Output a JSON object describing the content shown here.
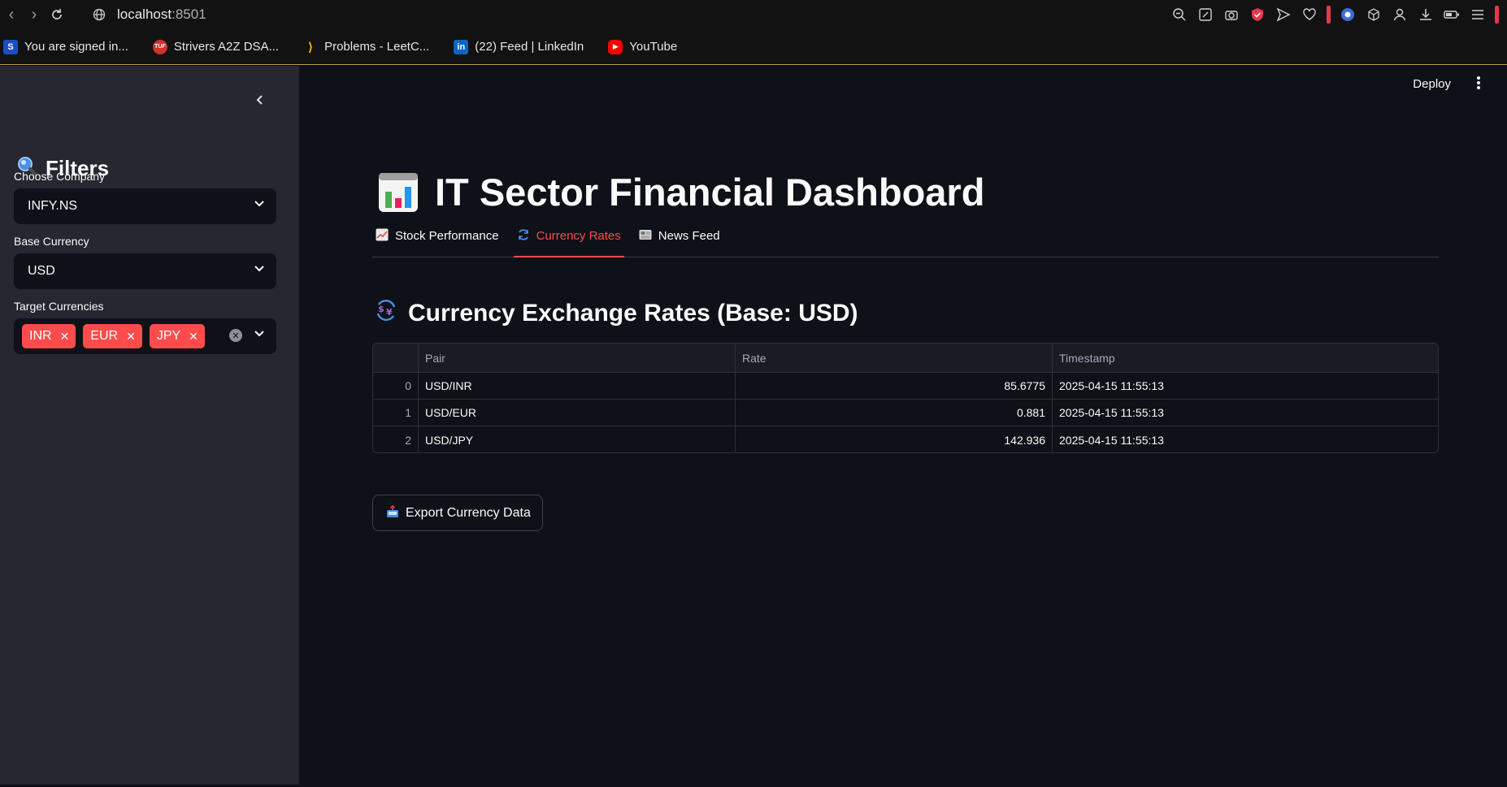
{
  "browser": {
    "url_host": "localhost",
    "url_port": ":8501",
    "bookmarks": [
      {
        "label": "You are signed in...",
        "icon": "s-icon",
        "color": "#1a73e8"
      },
      {
        "label": "Strivers A2Z DSA...",
        "icon": "tuf-icon",
        "color": "#e53935"
      },
      {
        "label": "Problems - LeetC...",
        "icon": "leetcode-icon",
        "color": "#f5a623"
      },
      {
        "label": "(22) Feed | LinkedIn",
        "icon": "linkedin-icon",
        "color": "#0a66c2"
      },
      {
        "label": "YouTube",
        "icon": "youtube-icon",
        "color": "#ff0000"
      }
    ]
  },
  "sidebar": {
    "title": "Filters",
    "company_label": "Choose Company",
    "company_value": "INFY.NS",
    "base_label": "Base Currency",
    "base_value": "USD",
    "target_label": "Target Currencies",
    "target_values": [
      "INR",
      "EUR",
      "JPY"
    ]
  },
  "header": {
    "deploy_label": "Deploy"
  },
  "main": {
    "title": "IT Sector Financial Dashboard",
    "tabs": [
      {
        "label": "Stock Performance",
        "active": false
      },
      {
        "label": "Currency Rates",
        "active": true
      },
      {
        "label": "News Feed",
        "active": false
      }
    ],
    "section_title": "Currency Exchange Rates (Base: USD)",
    "table": {
      "columns": [
        "",
        "Pair",
        "Rate",
        "Timestamp"
      ],
      "rows": [
        [
          "0",
          "USD/INR",
          "85.6775",
          "2025-04-15 11:55:13"
        ],
        [
          "1",
          "USD/EUR",
          "0.881",
          "2025-04-15 11:55:13"
        ],
        [
          "2",
          "USD/JPY",
          "142.936",
          "2025-04-15 11:55:13"
        ]
      ]
    },
    "export_label": "Export Currency Data"
  },
  "colors": {
    "accent": "#ff4b4b",
    "app_bg": "#0e1117",
    "sidebar_bg": "#262730"
  }
}
